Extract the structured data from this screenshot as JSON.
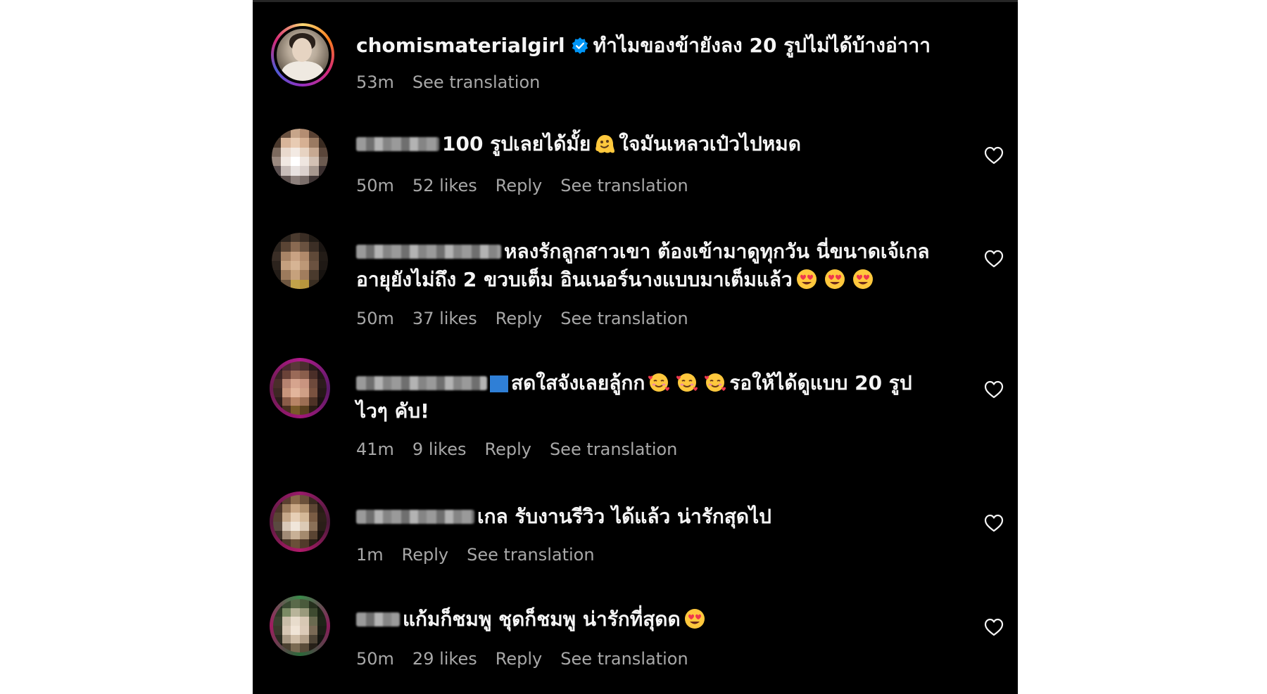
{
  "post_author": {
    "username": "chomismaterialgirl",
    "verified": true,
    "caption": "ทำไมของข้ายังลง 20 รูปไม่ได้บ้างอ่าาา",
    "time": "53m",
    "see_translation": "See translation"
  },
  "comments": [
    {
      "text": "100 รูปเลยได้มั้ย",
      "text_after_emoji": "ใจมันเหลวเป๋วไปหมด",
      "time": "50m",
      "likes": "52 likes",
      "reply": "Reply",
      "see_translation": "See translation"
    },
    {
      "text_line1": "หลงรักลูกสาวเขา ต้องเข้ามาดูทุกวัน นี่ขนาดเจ้เกล",
      "text_line2": "อายุยังไม่ถึง 2 ขวบเต็ม อินเนอร์นางแบบมาเต็มแล้ว",
      "time": "50m",
      "likes": "37 likes",
      "reply": "Reply",
      "see_translation": "See translation"
    },
    {
      "text_line1": "สดใสจังเลยลู้กก",
      "text_line1_after": "รอให้ได้ดูแบบ 20 รูป",
      "text_line2": "ไวๆ คับ!",
      "time": "41m",
      "likes": "9 likes",
      "reply": "Reply",
      "see_translation": "See translation"
    },
    {
      "text": "เกล รับงานรีวิว ได้แล้ว น่ารักสุดไป",
      "time": "1m",
      "reply": "Reply",
      "see_translation": "See translation"
    },
    {
      "text": "แก้มก็ชมพู ชุดก็ชมพู น่ารักที่สุดด",
      "time": "50m",
      "likes": "29 likes",
      "reply": "Reply",
      "see_translation": "See translation"
    }
  ],
  "icons": {
    "verified": "verified-badge-icon",
    "heart": "heart-outline-icon",
    "emoji_melting": "melting-face-emoji",
    "emoji_heart_eyes": "heart-eyes-emoji",
    "emoji_hearts_face": "smiling-face-with-hearts-emoji",
    "flag": "flag-emoji"
  },
  "colors": {
    "background": "#000000",
    "text_primary": "#f5f5f5",
    "text_secondary": "#a8a8a8",
    "verified_blue": "#0095f6"
  }
}
